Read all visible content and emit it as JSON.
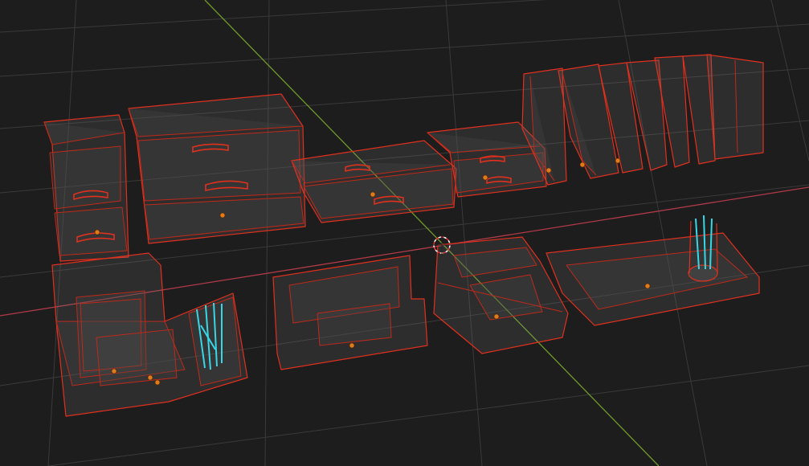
{
  "viewport": {
    "background": "#1d1d1d",
    "grid_color": "#3a3a3a",
    "wire_color": "#e0301e",
    "x_axis_color": "#b03a48",
    "y_axis_color": "#6e9a2a",
    "highlight_color": "#37d7e8",
    "origin_color": "#e07b1a"
  },
  "objects": [
    {
      "name": "tall-drawer-cabinet",
      "type": "drawer-unit"
    },
    {
      "name": "wide-two-drawer-cabinet",
      "type": "drawer-unit"
    },
    {
      "name": "low-drawer-unit",
      "type": "drawer-unit"
    },
    {
      "name": "small-drawer-unit",
      "type": "drawer-unit"
    },
    {
      "name": "book-stack",
      "type": "books"
    },
    {
      "name": "binder-row",
      "type": "binders"
    },
    {
      "name": "desk-organizer-with-pencils",
      "type": "organizer"
    },
    {
      "name": "letter-tray",
      "type": "tray"
    },
    {
      "name": "stacked-paper-trays",
      "type": "tray"
    },
    {
      "name": "long-tray-with-pen-cup",
      "type": "tray"
    }
  ],
  "cursor": {
    "icon": "3d-cursor-icon"
  }
}
